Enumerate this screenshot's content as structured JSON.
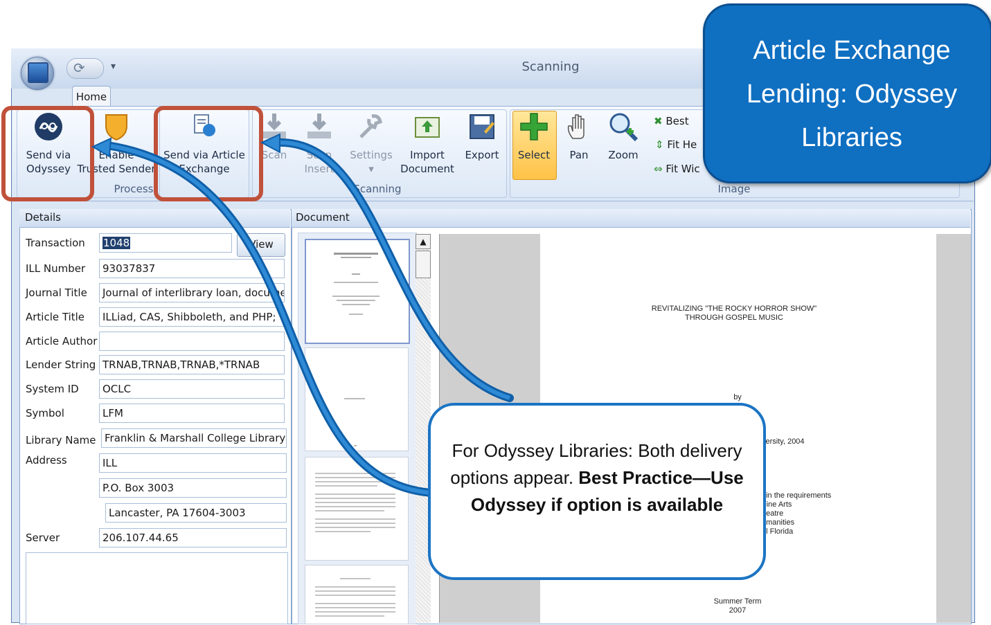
{
  "window": {
    "title": "Scanning",
    "tab_home": "Home"
  },
  "ribbon": {
    "process": {
      "label": "Process",
      "send_odyssey": [
        "Send via",
        "Odyssey"
      ],
      "enable_trusted": [
        "Enable",
        "Trusted Sender"
      ]
    },
    "send_article_exchange": [
      "Send via Article",
      "Exchange"
    ],
    "scanning": {
      "label": "Scanning",
      "scan": "Scan",
      "scan_insert": [
        "Scan",
        "Insert"
      ],
      "settings": "Settings",
      "import": [
        "Import",
        "Document"
      ],
      "export": "Export"
    },
    "image": {
      "label": "Image",
      "select": "Select",
      "pan": "Pan",
      "zoom": "Zoom",
      "best_fit": "Best",
      "fit_height": "Fit He",
      "fit_width": "Fit Wic"
    }
  },
  "details": {
    "title": "Details",
    "view_button": "View",
    "fields": {
      "transaction": {
        "label": "Transaction",
        "value": "1048"
      },
      "ill_number": {
        "label": "ILL Number",
        "value": "93037837"
      },
      "journal_title": {
        "label": "Journal Title",
        "value": "Journal of interlibrary loan, documer"
      },
      "article_title": {
        "label": "Article Title",
        "value": "ILLiad, CAS, Shibboleth, and PHP; T"
      },
      "article_author": {
        "label": "Article Author",
        "value": ""
      },
      "lender_string": {
        "label": "Lender String",
        "value": "TRNAB,TRNAB,TRNAB,*TRNAB"
      },
      "system_id": {
        "label": "System ID",
        "value": "OCLC"
      },
      "symbol": {
        "label": "Symbol",
        "value": "LFM"
      },
      "library_name": {
        "label": "Library Name",
        "value": "Franklin & Marshall College Library"
      },
      "address": {
        "label": "Address",
        "lines": [
          "ILL",
          "P.O. Box 3003",
          "Lancaster, PA 17604-3003"
        ]
      },
      "server": {
        "label": "Server",
        "value": "206.107.44.65"
      }
    }
  },
  "document": {
    "title": "Document",
    "page": {
      "title_line1": "REVITALIZING \"THE ROCKY HORROR SHOW\"",
      "title_line2": "THROUGH GOSPEL MUSIC",
      "by": "by",
      "uni": "versity, 2004",
      "req1": "t in the requirements",
      "req2": "Fine Arts",
      "req3": "heatre",
      "req4": "umanities",
      "req5": "al Florida",
      "term": "Summer Term",
      "year": "2007"
    }
  },
  "callouts": {
    "banner": [
      "Article Exchange",
      "Lending: Odyssey",
      "Libraries"
    ],
    "note_plain": "For Odyssey Libraries: Both delivery options appear.",
    "note_bold": "Best Practice—Use Odyssey if option is available"
  },
  "colors": {
    "banner_bg": "#0f6fc1",
    "highlight_red": "#c0513a",
    "arrow_blue": "#1b74c4"
  }
}
